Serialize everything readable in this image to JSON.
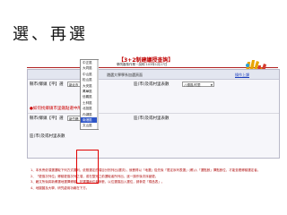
{
  "slide_title": "選、再選",
  "page_header": {
    "title": "【3+2制建議授查詢】",
    "subtitle": "學院審核作業－說明 103年1月27日"
  },
  "panel": {
    "caption": "遴選大學學系加選頁面",
    "help_link": "操作上課"
  },
  "form": {
    "row1": {
      "label_a": "縣市/鄉鎮【平】選",
      "select_a": "新北市",
      "label_b": "區(市)及或村里表數",
      "select_b": "八德區/村里"
    },
    "row2": {
      "note": "●如何找鄉鎮市里鐵點選中所系統"
    },
    "row3": {
      "label_a": "縣市/鄉鎮【平】選",
      "select_a": "新竹縣",
      "label_b": "區(市)及或村里表數"
    },
    "row4": {
      "label_b": "區(市)及或村里表數"
    }
  },
  "dropdown": {
    "options": [
      "中正區",
      "大同區",
      "中山區",
      "松山區",
      "大安區",
      "萬華區",
      "信義區",
      "士林區",
      "北投區",
      "內湖區",
      "南港區",
      "文山區"
    ],
    "selected": "南港區"
  },
  "instructions": [
    "1、本系會依項選選取下列方式擺列，依照選定的項目分別列出(選次)，就餐得以「地選」從先後「限定序列表選」(鄉)入「選點數」擇點數位，才能查看鄉鎮選定者。",
    "2、「更換次列位」鄉鎮更換次列之項，或在整完之前選取者所列出，逐一操作後次序變更。",
    "3、藉文所後將新鄉選地選擇鄉鎮，於選擇地位者參數，以位選換加入選位，請參見「樣品表」。",
    "4、地圖圖及大學、研究處用功報在下方。"
  ],
  "colors": {
    "accent_red": "#cc0000",
    "selected_blue": "#2e55c7",
    "link_blue": "#1a3dbd"
  },
  "icons": [
    "logo-hands-icon",
    "chevron-down-icon"
  ]
}
